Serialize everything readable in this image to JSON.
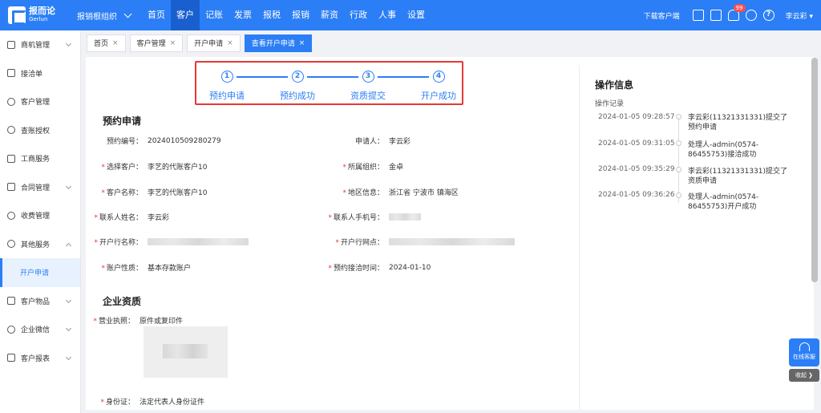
{
  "topbar": {
    "logo_cn": "报而论",
    "logo_en": "Gerlun",
    "org": "报销根组织",
    "nav": [
      "首页",
      "客户",
      "记账",
      "发票",
      "报税",
      "报销",
      "薪资",
      "行政",
      "人事",
      "设置"
    ],
    "active_nav": "客户",
    "download": "下载客户端",
    "badge": "99",
    "user": "李云彩"
  },
  "sidebar": {
    "items": [
      {
        "label": "商机管理",
        "chev": "down"
      },
      {
        "label": "接洽单",
        "chev": ""
      },
      {
        "label": "客户管理",
        "chev": ""
      },
      {
        "label": "查账授权",
        "chev": ""
      },
      {
        "label": "工商服务",
        "chev": ""
      },
      {
        "label": "合同管理",
        "chev": "down"
      },
      {
        "label": "收费管理",
        "chev": ""
      },
      {
        "label": "其他服务",
        "chev": "up"
      },
      {
        "label": "开户申请",
        "chev": "",
        "active": true,
        "sub": true
      },
      {
        "label": "客户物品",
        "chev": "down"
      },
      {
        "label": "企业微信",
        "chev": "down"
      },
      {
        "label": "客户报表",
        "chev": "down"
      }
    ]
  },
  "tabs": [
    {
      "label": "首页",
      "x": "×"
    },
    {
      "label": "客户管理",
      "x": "×"
    },
    {
      "label": "开户申请",
      "x": "×"
    },
    {
      "label": "查看开户申请",
      "x": "×",
      "active": true
    }
  ],
  "steps": [
    {
      "num": "1",
      "label": "预约申请"
    },
    {
      "num": "2",
      "label": "预约成功"
    },
    {
      "num": "3",
      "label": "资质提交"
    },
    {
      "num": "4",
      "label": "开户成功"
    }
  ],
  "booking": {
    "title": "预约申请",
    "booking_no_label": "预约编号：",
    "booking_no": "2024010509280279",
    "applicant_label": "申请人：",
    "applicant": "李云彩",
    "customer_label": "选择客户：",
    "customer": "李艺的代账客户10",
    "org_label": "所属组织：",
    "org": "金卓",
    "cust_name_label": "客户名称：",
    "cust_name": "李艺的代账客户10",
    "region_label": "地区信息：",
    "region": "浙江省  宁波市  镇海区",
    "contact_label": "联系人姓名：",
    "contact": "李云彩",
    "phone_label": "联系人手机号：",
    "bank_label": "开户行名称：",
    "branch_label": "开户行网点：",
    "acct_type_label": "账户性质：",
    "acct_type": "基本存款账户",
    "date_label": "预约接洽时间：",
    "date": "2024-01-10"
  },
  "qualification": {
    "title": "企业资质",
    "license_label": "营业执照：",
    "license_note": "原件或复印件",
    "id_label": "身份证：",
    "id_note": "法定代表人身份证件"
  },
  "ops": {
    "title": "操作信息",
    "subtitle": "操作记录",
    "logs": [
      {
        "time": "2024-01-05 09:28:57",
        "text": "李云彩(11321331331)提交了预约申请"
      },
      {
        "time": "2024-01-05 09:31:05",
        "text": "处理人-admin(0574-86455753)接洽成功"
      },
      {
        "time": "2024-01-05 09:35:29",
        "text": "李云彩(11321331331)提交了资质申请"
      },
      {
        "time": "2024-01-05 09:36:26",
        "text": "处理人-admin(0574-86455753)开户成功"
      }
    ]
  },
  "widgets": {
    "service": "在线客服",
    "collapse": "收起 ❯"
  }
}
